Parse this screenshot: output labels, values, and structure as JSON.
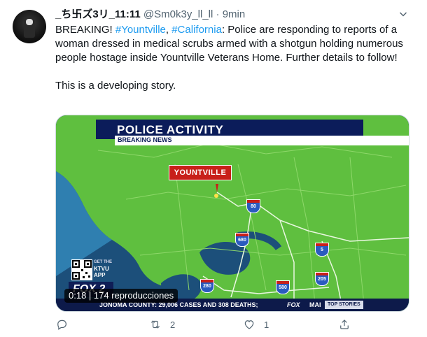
{
  "tweet": {
    "display_name": "_ち卐ズ3リ_11:11",
    "handle": "@Sm0k3y_ll_ll",
    "separator": "·",
    "time": "9min",
    "text_prefix": "BREAKING! ",
    "hashtag_1": "#Yountville",
    "comma": ", ",
    "hashtag_2": "#California",
    "text_body": ": Police are responding to reports of a woman dressed in medical scrubs armed with a shotgun holding numerous people hostage inside Yountville Veterans Home. Further details to follow!",
    "text_footer": "This is a developing story."
  },
  "media": {
    "banner_title": "POLICE ACTIVITY",
    "breaking_label": "BREAKING NEWS",
    "location_pin": "YOUNTVILLE",
    "ticker_text": "JONOMA COUNTY: 29,006 CASES AND 308 DEATHS;",
    "ticker_fox": "FOX",
    "ticker_more": "MAI",
    "ticker_top": "TOP STORIES",
    "app_label": "GET THE",
    "app_name_1": "KTVU",
    "app_name_2": "APP",
    "fox_logo": "FOX 2",
    "video_badge": "0:18 | 174 reproducciones",
    "highway_80": "80",
    "highway_680": "680",
    "highway_5": "5",
    "highway_205": "205",
    "highway_280": "280",
    "highway_580": "580"
  },
  "actions": {
    "reply_count": "",
    "retweet_count": "2",
    "like_count": "1"
  },
  "icons": {
    "more": "more-icon",
    "reply": "reply-icon",
    "retweet": "retweet-icon",
    "like": "heart-icon",
    "share": "share-icon"
  },
  "colors": {
    "link": "#1d9bf0",
    "muted": "#536471",
    "map_land": "#5fbf3f",
    "map_water": "#1c4f7a"
  }
}
